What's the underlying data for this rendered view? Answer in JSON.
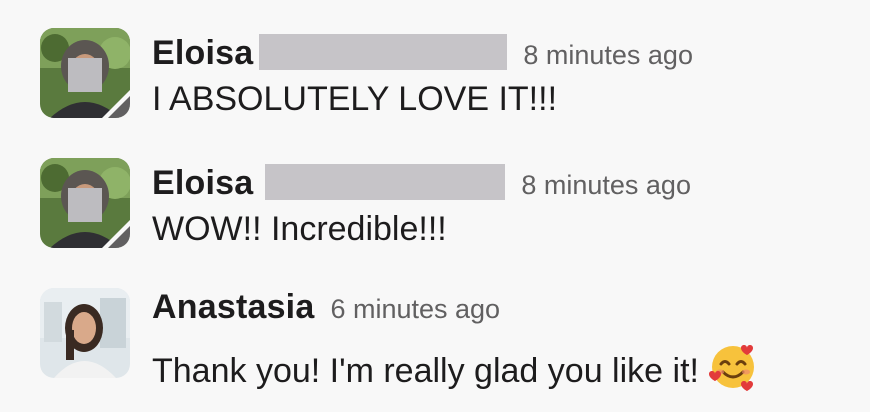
{
  "messages": [
    {
      "author": "Eloisa",
      "time": "8 minutes ago",
      "text": "I ABSOLUTELY LOVE IT!!!",
      "avatar": "eloisa-photo",
      "name_redacted": true
    },
    {
      "author": "Eloisa",
      "time": "8 minutes ago",
      "text": "WOW!! Incredible!!!",
      "avatar": "eloisa-photo",
      "name_redacted": true
    },
    {
      "author": "Anastasia",
      "time": "6 minutes ago",
      "text": "Thank you! I'm really glad you like it!",
      "avatar": "anastasia-photo",
      "emoji": "smiling-face-with-hearts"
    }
  ],
  "colors": {
    "background": "#f8f8f8",
    "text": "#1d1c1d",
    "timestamp": "#616061",
    "redaction": "#c6c4c8"
  }
}
